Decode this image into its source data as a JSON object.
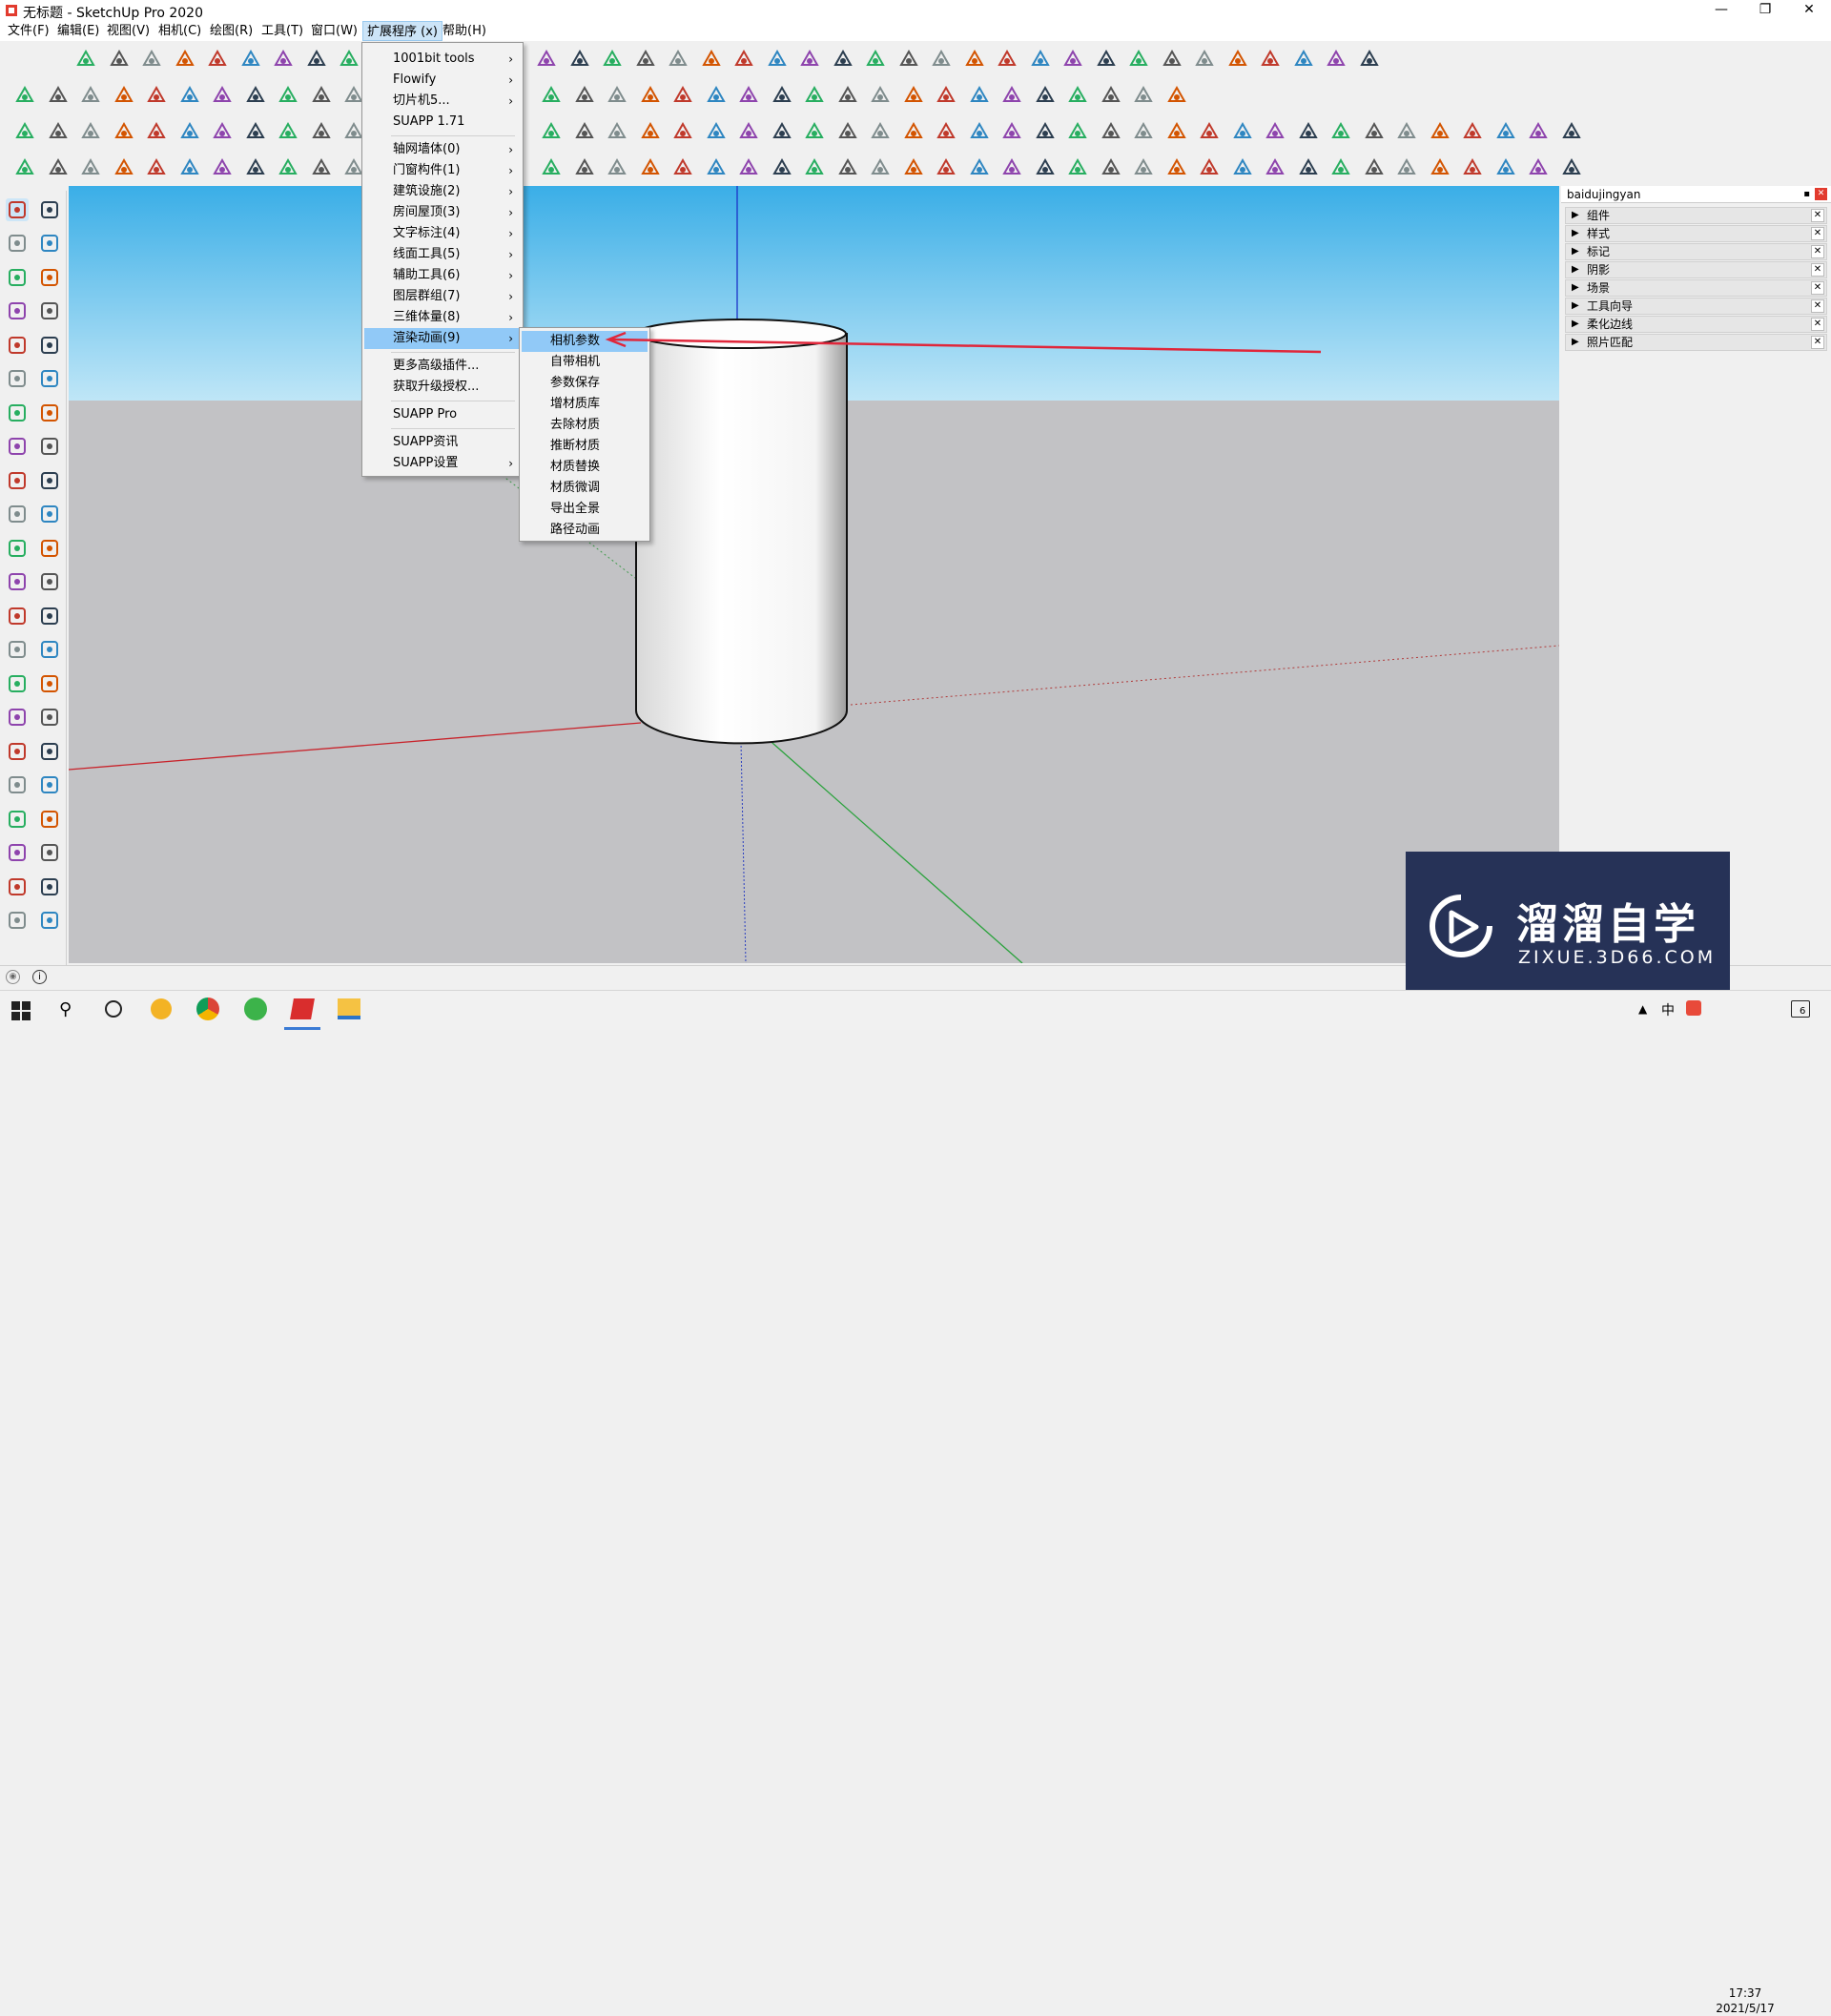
{
  "window": {
    "title": "无标题 - SketchUp Pro 2020",
    "app_icon": "sketchup-logo-icon",
    "controls": [
      "minimize-icon",
      "restore-icon",
      "close-icon"
    ]
  },
  "menubar": [
    "文件(F)",
    "编辑(E)",
    "视图(V)",
    "相机(C)",
    "绘图(R)",
    "工具(T)",
    "窗口(W)",
    "扩展程序 (x)",
    "帮助(H)"
  ],
  "extensions_menu": {
    "items": [
      {
        "label": "1001bit tools",
        "submenu": true
      },
      {
        "label": "Flowify",
        "submenu": true
      },
      {
        "label": "切片机5...",
        "submenu": true
      },
      {
        "label": "SUAPP 1.71",
        "submenu": false
      },
      {
        "label": "轴网墙体(0)",
        "submenu": true
      },
      {
        "label": "门窗构件(1)",
        "submenu": true
      },
      {
        "label": "建筑设施(2)",
        "submenu": true
      },
      {
        "label": "房间屋顶(3)",
        "submenu": true
      },
      {
        "label": "文字标注(4)",
        "submenu": true
      },
      {
        "label": "线面工具(5)",
        "submenu": true
      },
      {
        "label": "辅助工具(6)",
        "submenu": true
      },
      {
        "label": "图层群组(7)",
        "submenu": true
      },
      {
        "label": "三维体量(8)",
        "submenu": true
      },
      {
        "label": "渲染动画(9)",
        "submenu": true,
        "highlighted": true
      },
      {
        "label": "更多高级插件...",
        "submenu": false
      },
      {
        "label": "获取升级授权...",
        "submenu": false
      },
      {
        "label": "SUAPP Pro",
        "submenu": false
      },
      {
        "label": "SUAPP资讯",
        "submenu": false
      },
      {
        "label": "SUAPP设置",
        "submenu": true
      }
    ]
  },
  "render_submenu": {
    "items": [
      "相机参数",
      "自带相机",
      "参数保存",
      "增材质库",
      "去除材质",
      "推断材质",
      "材质替换",
      "材质微调",
      "导出全景",
      "路径动画"
    ],
    "highlighted": "相机参数"
  },
  "tray": {
    "title": "baidujingyan",
    "panels": [
      "组件",
      "样式",
      "标记",
      "阴影",
      "场景",
      "工具向导",
      "柔化边线",
      "照片匹配"
    ]
  },
  "watermark": {
    "cn": "溜溜自学",
    "en": "ZIXUE.3D66.COM",
    "logo": "play-logo-icon"
  },
  "taskbar": {
    "time": "17:37",
    "date": "2021/5/17",
    "notification_count": "6",
    "apps": [
      "windows-start-icon",
      "search-icon",
      "cortana-icon",
      "app-icon",
      "chrome-icon",
      "browser-icon",
      "sketchup-icon",
      "file-explorer-icon"
    ]
  },
  "colors": {
    "highlight": "#91c9f7",
    "sky": "#3aaee7",
    "ground": "#c2c2c5",
    "arrow": "#e0263a"
  }
}
